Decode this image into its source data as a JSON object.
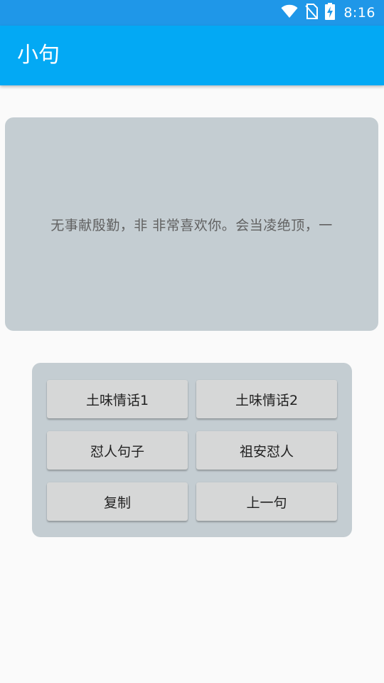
{
  "status_bar": {
    "time": "8:16",
    "icons": [
      "wifi-icon",
      "no-sim-icon",
      "battery-charging-icon"
    ],
    "background": "#1f97e8"
  },
  "app_bar": {
    "title": "小句",
    "background": "#03a9f4"
  },
  "quote": {
    "text": "无事献殷勤，非 非常喜欢你。会当凌绝顶，一"
  },
  "buttons": {
    "love_1": "土味情话1",
    "love_2": "土味情话2",
    "roast": "怼人句子",
    "zuan_roast": "祖安怼人",
    "copy": "复制",
    "previous": "上一句"
  },
  "colors": {
    "panel": "#c4cdd2",
    "button": "#d6d7d7",
    "page_background": "#fafafa"
  }
}
